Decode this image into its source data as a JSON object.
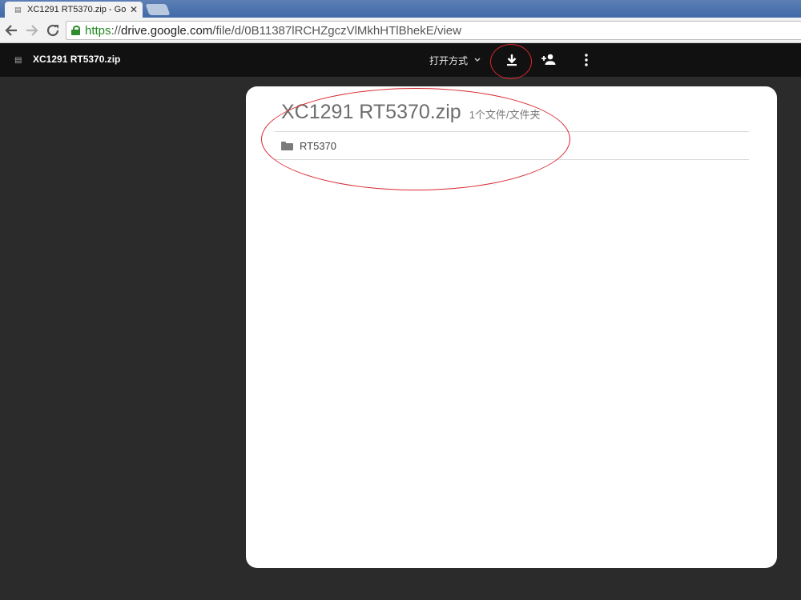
{
  "browser": {
    "tab_title": "XC1291 RT5370.zip - Go",
    "tab_close": "✕",
    "url_scheme": "https",
    "url_sep": "://",
    "url_host": "drive.google.com",
    "url_path": "/file/d/0B11387lRCHZgczVlMkhHTlBhekE/view"
  },
  "header": {
    "file_name": "XC1291 RT5370.zip",
    "open_with_label": "打开方式",
    "icons": [
      "file-icon",
      "chevron-down-icon",
      "download-icon",
      "add-person-icon",
      "more-vert-icon"
    ]
  },
  "card": {
    "title": "XC1291 RT5370.zip",
    "count": "1个文件/文件夹",
    "items": [
      {
        "name": "RT5370",
        "icon": "folder-icon"
      }
    ]
  },
  "colors": {
    "background": "#2b2b2b",
    "header": "#111111",
    "annotation": "#d9272e",
    "secure": "#1e8a1e"
  }
}
